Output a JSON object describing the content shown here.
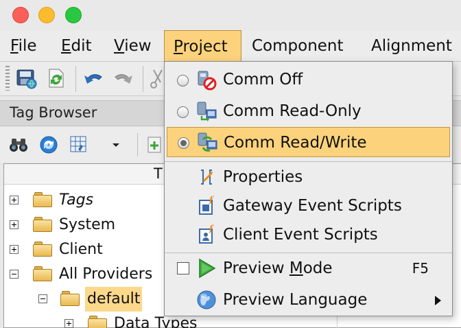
{
  "menubar": {
    "items": [
      {
        "label": "File",
        "u": "F",
        "rest": "ile"
      },
      {
        "label": "Edit",
        "u": "E",
        "rest": "dit"
      },
      {
        "label": "View",
        "u": "V",
        "rest": "iew"
      },
      {
        "label": "Project",
        "u": "P",
        "rest": "roject",
        "active": true
      },
      {
        "label": "Component"
      },
      {
        "label": "Alignment"
      }
    ]
  },
  "tag_browser": {
    "title": "Tag Browser",
    "column_header": "T",
    "tree": [
      {
        "label": "Tags",
        "italic": true,
        "expander": "plus"
      },
      {
        "label": "System",
        "expander": "plus"
      },
      {
        "label": "Client",
        "expander": "plus"
      },
      {
        "label": "All Providers",
        "expander": "minus"
      },
      {
        "label": "default",
        "expander": "minus",
        "selected": true
      },
      {
        "label": "Data Types",
        "expander": "plus"
      }
    ]
  },
  "project_menu": {
    "items": [
      {
        "label": "Comm Off",
        "radio": "off",
        "icon": "comm-off-icon"
      },
      {
        "label": "Comm Read-Only",
        "radio": "off",
        "icon": "comm-read-only-icon"
      },
      {
        "label": "Comm Read/Write",
        "radio": "on",
        "icon": "comm-read-write-icon",
        "highlighted": true
      },
      {
        "label": "Properties",
        "icon": "properties-icon"
      },
      {
        "label": "Gateway Event Scripts",
        "icon": "gateway-scripts-icon"
      },
      {
        "label": "Client Event Scripts",
        "icon": "client-scripts-icon"
      },
      {
        "label": "Preview Mode",
        "label_pre": "Preview ",
        "label_u": "M",
        "label_post": "ode",
        "accelerator": "F5",
        "checkbox": false,
        "icon": "play-icon"
      },
      {
        "label": "Preview Language",
        "icon": "globe-icon",
        "submenu": true
      }
    ]
  },
  "colors": {
    "menu_highlight": "#fcd37c",
    "tree_selection": "#fcd88b"
  }
}
